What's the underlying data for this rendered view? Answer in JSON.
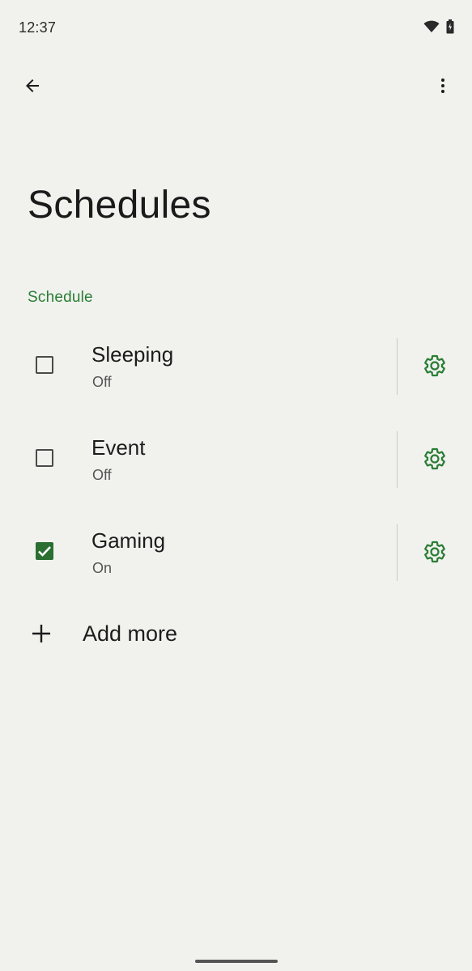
{
  "status_bar": {
    "time": "12:37",
    "icons": [
      "wifi-icon",
      "battery-icon"
    ]
  },
  "app_bar": {
    "back_icon": "arrow-back-icon",
    "overflow_icon": "more-vert-icon"
  },
  "page": {
    "title": "Schedules",
    "section_header": "Schedule"
  },
  "schedules": [
    {
      "name": "Sleeping",
      "status": "Off",
      "checked": false
    },
    {
      "name": "Event",
      "status": "Off",
      "checked": false
    },
    {
      "name": "Gaming",
      "status": "On",
      "checked": true
    }
  ],
  "add_more": {
    "label": "Add more",
    "icon": "plus-icon"
  },
  "colors": {
    "background": "#f1f2ee",
    "accent": "#2a7d35",
    "checkbox_checked": "#2a6e32"
  }
}
